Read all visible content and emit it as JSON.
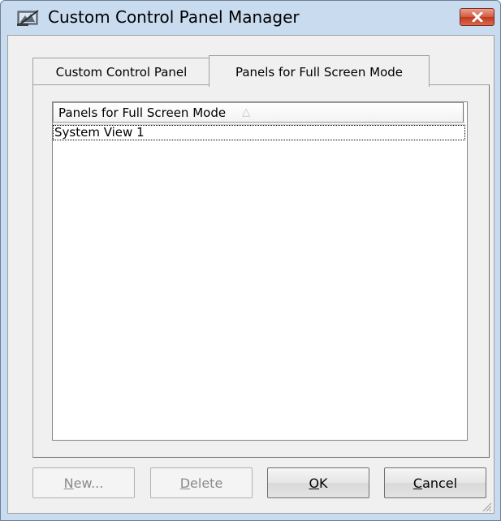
{
  "window": {
    "title": "Custom Control Panel Manager",
    "close_icon": "close-x-icon"
  },
  "tabs": [
    {
      "label": "Custom Control Panel",
      "active": false
    },
    {
      "label": "Panels for Full Screen Mode",
      "active": true
    }
  ],
  "list": {
    "column_header": "Panels for Full Screen Mode",
    "sort_indicator": "△",
    "rows": [
      "System View 1"
    ]
  },
  "buttons": {
    "new": {
      "mnemonic": "N",
      "rest": "ew...",
      "enabled": false
    },
    "delete": {
      "mnemonic": "D",
      "rest": "elete",
      "enabled": false
    },
    "ok": {
      "mnemonic": "O",
      "rest": "K",
      "enabled": true
    },
    "cancel": {
      "mnemonic": "C",
      "rest": "ancel",
      "enabled": true
    }
  },
  "colors": {
    "title_bar": "#c9dbef",
    "close_button": "#c0391f",
    "dialog_face": "#f0f0f0"
  }
}
